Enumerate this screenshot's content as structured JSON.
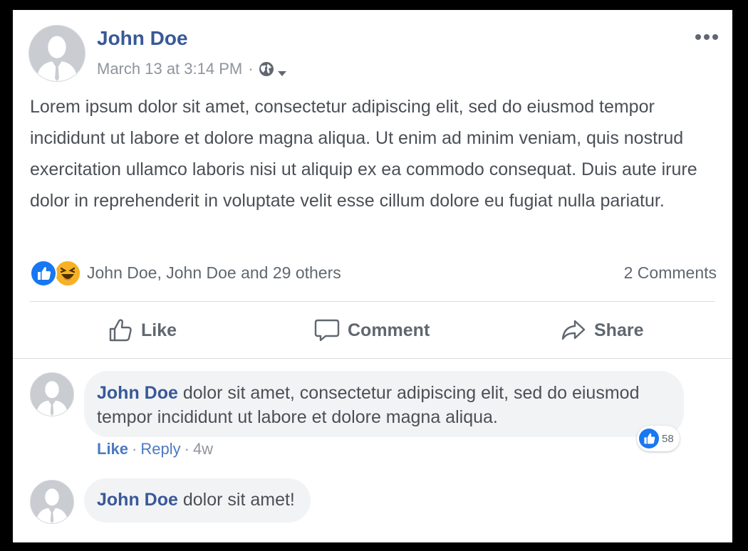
{
  "post": {
    "author": "John Doe",
    "timestamp": "March 13 at 3:14 PM",
    "separator": "·",
    "privacy_icon": "globe-icon",
    "body": "Lorem ipsum dolor sit amet, consectetur adipiscing elit, sed do eiusmod tempor incididunt ut labore et dolore magna aliqua. Ut enim ad minim veniam, quis nostrud exercitation ullamco laboris nisi ut aliquip ex ea commodo consequat. Duis aute irure dolor in reprehenderit in voluptate velit esse cillum dolore eu fugiat nulla pariatur."
  },
  "reactions": {
    "summary": "John Doe, John Doe and 29 others",
    "comments_count": "2 Comments"
  },
  "actions": {
    "like": "Like",
    "comment": "Comment",
    "share": "Share"
  },
  "comments": [
    {
      "author": "John Doe",
      "text": "dolor sit amet, consectetur adipiscing elit, sed do eiusmod tempor incididunt ut labore et dolore magna aliqua.",
      "like_label": "Like",
      "reply_label": "Reply",
      "age": "4w",
      "separator": "·",
      "reaction_count": "58"
    },
    {
      "author": "John Doe",
      "text": "dolor sit amet!"
    }
  ],
  "colors": {
    "brand_blue": "#385898",
    "like_blue": "#1877f2",
    "haha_yellow": "#f7b125",
    "text_gray": "#606770"
  }
}
